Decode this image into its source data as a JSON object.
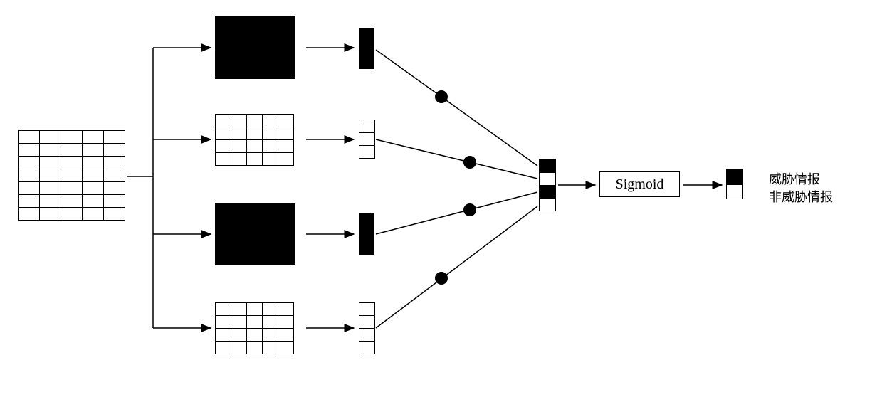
{
  "sigmoid_label": "Sigmoid",
  "output_label_top": "威胁情报",
  "output_label_bottom": "非威胁情报"
}
